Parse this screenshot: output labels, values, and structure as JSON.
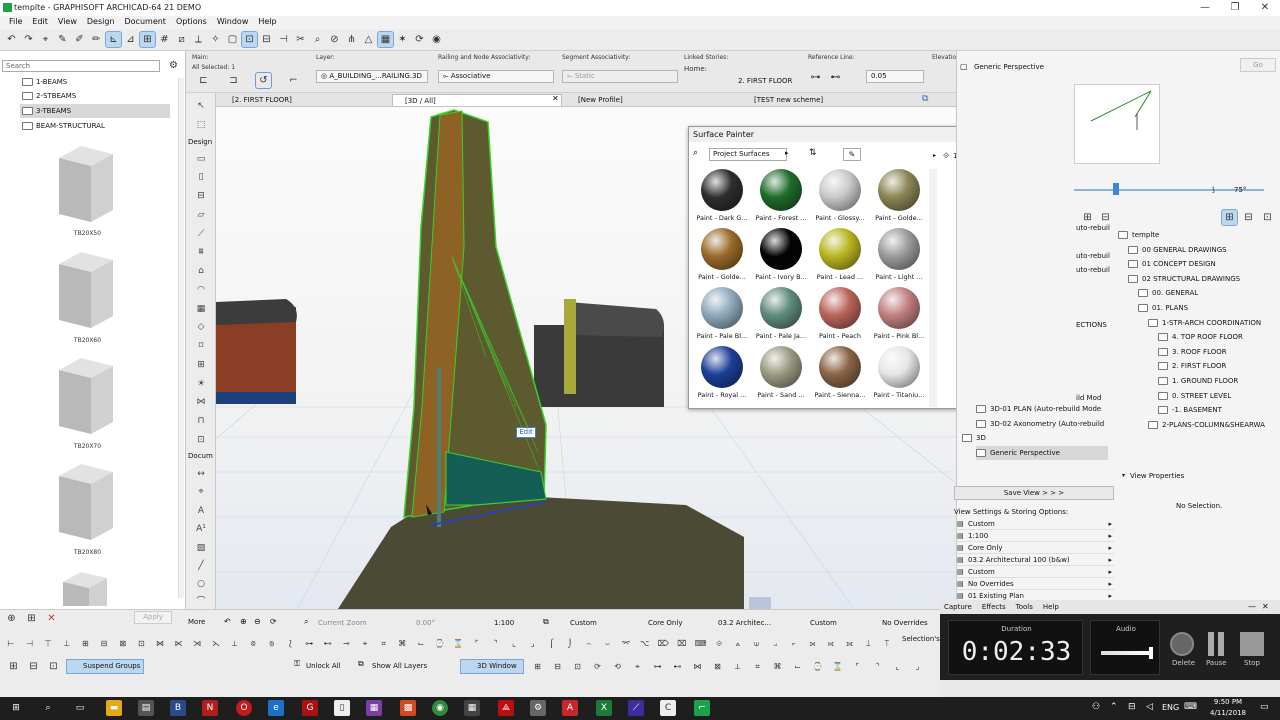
{
  "window": {
    "title": "templte - GRAPHISOFT ARCHICAD-64 21 DEMO",
    "controls": [
      "—",
      "❐",
      "✕"
    ]
  },
  "menu": [
    "File",
    "Edit",
    "View",
    "Design",
    "Document",
    "Options",
    "Window",
    "Help"
  ],
  "infobox": {
    "main_label": "Main:",
    "all_selected": "All Selected: 1",
    "layer_label": "Layer:",
    "layer_value": "A_BUILDING_...RAILING.3D",
    "railing_label": "Railing and Node Associativity:",
    "railing_value": "Associative",
    "segment_label": "Segment Associativity:",
    "segment_value": "Static",
    "linked_label": "Linked Stories:",
    "home_label": "Home:",
    "home_value": "2. FIRST FLOOR",
    "reference_label": "Reference Line:",
    "reference_value": "0.05",
    "elevation_label": "Elevatio"
  },
  "left_panel": {
    "search_placeholder": "Search",
    "tree": [
      {
        "label": "1-BEAMS",
        "selected": false
      },
      {
        "label": "2-STBEAMS",
        "selected": false
      },
      {
        "label": "3-TBEAMS",
        "selected": true
      },
      {
        "label": "BEAM-STRUCTURAL",
        "selected": false
      }
    ],
    "beams": [
      "TB20X50",
      "TB20X60",
      "TB20X70",
      "TB20X80"
    ]
  },
  "toolbox": {
    "design_label": "Design",
    "document_label": "Docum",
    "more_label": "More"
  },
  "tabs": [
    "[2. FIRST FLOOR]",
    "[3D / All]",
    "[New Profile]",
    "[TEST new scheme]"
  ],
  "viewport": {
    "edit_label": "Edit"
  },
  "surface_painter": {
    "title": "Surface Painter",
    "search_value": "Project Surfaces",
    "count_a": "1",
    "count_b": "0",
    "swatches": [
      {
        "label": "Paint - Dark G...",
        "color": "#2e2e2e"
      },
      {
        "label": "Paint - Forest ...",
        "color": "#1f6b2a"
      },
      {
        "label": "Paint - Glossy...",
        "color": "#c9c9c9"
      },
      {
        "label": "Paint - Golde...",
        "color": "#8a8655"
      },
      {
        "label": "Paint - Golde...",
        "color": "#9a6a2a"
      },
      {
        "label": "Paint - Ivory B...",
        "color": "#050505"
      },
      {
        "label": "Paint - Lead ...",
        "color": "#b8b520"
      },
      {
        "label": "Paint - Light ...",
        "color": "#9b9b9b"
      },
      {
        "label": "Paint - Pale Bl...",
        "color": "#8fa9bc"
      },
      {
        "label": "Paint - Pale Ja...",
        "color": "#5f8c7c"
      },
      {
        "label": "Paint - Peach",
        "color": "#b9655a"
      },
      {
        "label": "Paint - Pink Bl...",
        "color": "#c27f7f"
      },
      {
        "label": "Paint - Royal ...",
        "color": "#1d3f98"
      },
      {
        "label": "Paint - Sand ...",
        "color": "#9c9a82"
      },
      {
        "label": "Paint - Sienna...",
        "color": "#8a6447"
      },
      {
        "label": "Paint - Titaniu...",
        "color": "#e6e6e6"
      }
    ]
  },
  "right_panel": {
    "view_title": "Generic Perspective",
    "go_label": "Go",
    "angle": "75°",
    "rebuild_labels": [
      "uto-rebuil",
      "uto-rebuil",
      "uto-rebuil",
      "ECTIONS",
      "ild Mod"
    ],
    "tree": [
      {
        "label": "templte",
        "indent": 0
      },
      {
        "label": "00 GENERAL DRAWINGS",
        "indent": 1
      },
      {
        "label": "01 CONCEPT DESIGN",
        "indent": 1
      },
      {
        "label": "02 STRUCTURAL DRAWINGS",
        "indent": 1
      },
      {
        "label": "00. GENERAL",
        "indent": 2
      },
      {
        "label": "01. PLANS",
        "indent": 2
      },
      {
        "label": "1-STR-ARCH COORDINATION",
        "indent": 3
      },
      {
        "label": "4. TOP ROOF FLOOR",
        "indent": 4
      },
      {
        "label": "3. ROOF FLOOR",
        "indent": 4
      },
      {
        "label": "2. FIRST FLOOR",
        "indent": 4
      },
      {
        "label": "1. GROUND FLOOR",
        "indent": 4
      },
      {
        "label": "0. STREET LEVEL",
        "indent": 4
      },
      {
        "label": "-1. BASEMENT",
        "indent": 4
      },
      {
        "label": "2-PLANS-COLUMN&SHEARWA",
        "indent": 3
      }
    ],
    "view_tree": [
      {
        "label": "3D-01 PLAN (Auto-rebuild Mode",
        "indent": 1
      },
      {
        "label": "3D-02 Axonometry (Auto-rebuild",
        "indent": 1
      },
      {
        "label": "3D",
        "indent": 0
      },
      {
        "label": "Generic Perspective",
        "indent": 1
      }
    ],
    "save_view": "Save View > > >",
    "view_properties": "View Properties",
    "no_selection": "No Selection.",
    "settings_title": "View Settings & Storing Options:",
    "settings": [
      "Custom",
      "1:100",
      "Core Only",
      "03.2 Architectural 100 (b&w)",
      "Custom",
      "No Overrides",
      "01 Existing Plan"
    ]
  },
  "status_bar": {
    "apply_label": "Apply",
    "zoom_label": "Current Zoom",
    "angle": "0.00°",
    "scale": "1:100",
    "custom1": "Custom",
    "core_only": "Core Only",
    "arch": "03.2 Architec...",
    "custom2": "Custom",
    "overrides": "No Overrides",
    "selections": "Selection's"
  },
  "bottom_toolbar": {
    "suspend_groups": "Suspend Groups",
    "unlock_all": "Unlock All",
    "show_all_layers": "Show All Layers",
    "window_3d": "3D Window"
  },
  "recorder": {
    "menu": [
      "Capture",
      "Effects",
      "Tools",
      "Help"
    ],
    "duration_label": "Duration",
    "duration": "0:02:33",
    "audio_label": "Audio",
    "delete_label": "Delete",
    "pause_label": "Pause",
    "stop_label": "Stop"
  },
  "taskbar": {
    "time": "9:50 PM",
    "date": "4/11/2018",
    "lang": "ENG"
  }
}
